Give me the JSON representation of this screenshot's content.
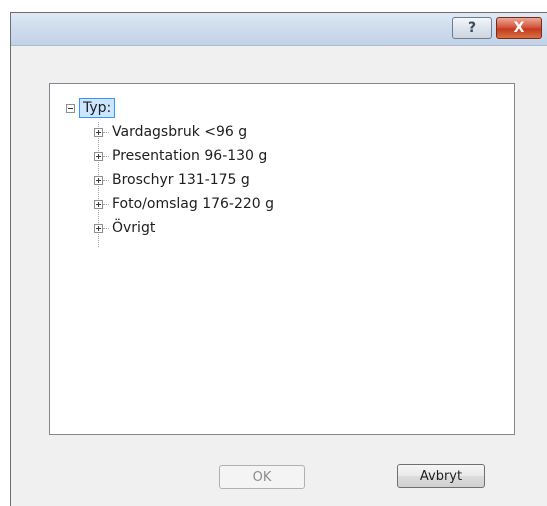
{
  "window": {
    "help_label": "?",
    "close_label": "X"
  },
  "tree": {
    "root_label": "Typ:",
    "items": [
      {
        "label": "Vardagsbruk <96 g"
      },
      {
        "label": "Presentation 96-130 g"
      },
      {
        "label": "Broschyr 131-175 g"
      },
      {
        "label": "Foto/omslag 176-220 g"
      },
      {
        "label": "Övrigt"
      }
    ]
  },
  "buttons": {
    "ok_label": "OK",
    "cancel_label": "Avbryt"
  }
}
